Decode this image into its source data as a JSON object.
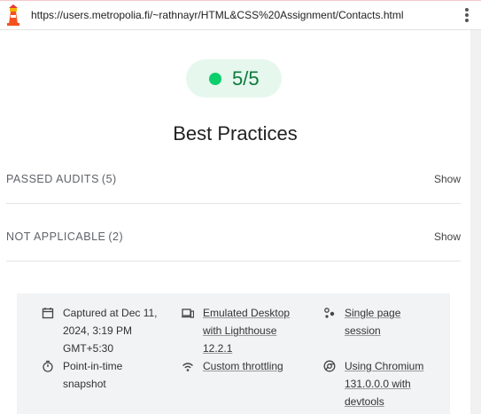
{
  "browser": {
    "url": "https://users.metropolia.fi/~rathnayr/HTML&CSS%20Assignment/Contacts.html",
    "menu_icon": "kebab-menu-icon"
  },
  "category": {
    "score": "5/5",
    "title": "Best Practices",
    "score_color": "#0cce6b"
  },
  "groups": [
    {
      "title": "PASSED AUDITS",
      "count": "(5)",
      "action": "Show"
    },
    {
      "title": "NOT APPLICABLE",
      "count": "(2)",
      "action": "Show"
    }
  ],
  "runtime": {
    "captured": "Captured at Dec 11, 2024, 3:19 PM GMT+5:30",
    "emulated": "Emulated Desktop with Lighthouse 12.2.1",
    "session": "Single page session",
    "snapshot": "Point-in-time snapshot",
    "throttling": "Custom throttling",
    "chromium": "Using Chromium 131.0.0.0 with devtools"
  }
}
